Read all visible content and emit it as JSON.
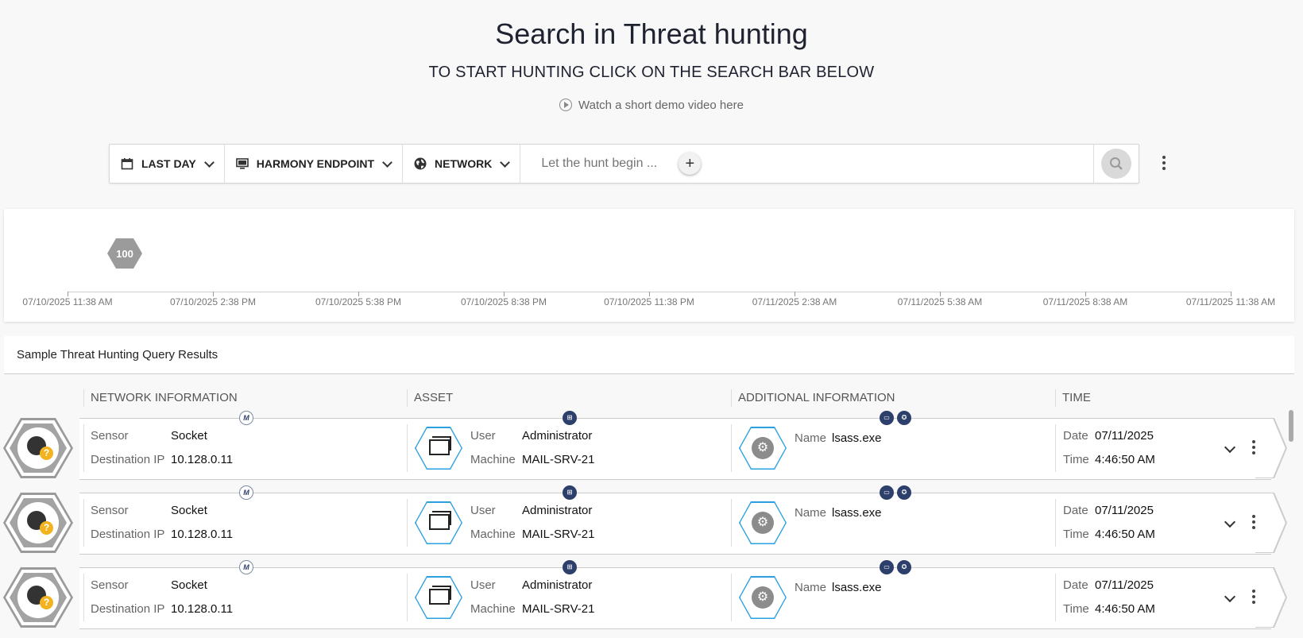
{
  "hero": {
    "title": "Search in Threat hunting",
    "subtitle": "TO START HUNTING CLICK ON THE SEARCH BAR BELOW",
    "demo_link": "Watch a short demo video here"
  },
  "search": {
    "filters": [
      {
        "label": "LAST DAY",
        "icon": "calendar-icon"
      },
      {
        "label": "HARMONY ENDPOINT",
        "icon": "monitor-icon"
      },
      {
        "label": "NETWORK",
        "icon": "globe-icon"
      }
    ],
    "placeholder": "Let the hunt begin ..."
  },
  "timeline": {
    "badge": "100",
    "ticks": [
      "07/10/2025 11:38 AM",
      "07/10/2025 2:38 PM",
      "07/10/2025 5:38 PM",
      "07/10/2025 8:38 PM",
      "07/10/2025 11:38 PM",
      "07/11/2025 2:38 AM",
      "07/11/2025 5:38 AM",
      "07/11/2025 8:38 AM",
      "07/11/2025 11:38 AM"
    ]
  },
  "results": {
    "title": "Sample Threat Hunting Query Results",
    "columns": [
      "NETWORK INFORMATION",
      "ASSET",
      "ADDITIONAL INFORMATION",
      "TIME"
    ],
    "labels": {
      "sensor": "Sensor",
      "destination_ip": "Destination IP",
      "user": "User",
      "machine": "Machine",
      "name": "Name",
      "date": "Date",
      "time": "Time"
    },
    "rows": [
      {
        "sensor": "Socket",
        "destination_ip": "10.128.0.11",
        "user": "Administrator",
        "machine": "MAIL-SRV-21",
        "name": "lsass.exe",
        "date": "07/11/2025",
        "time": "4:46:50 AM"
      },
      {
        "sensor": "Socket",
        "destination_ip": "10.128.0.11",
        "user": "Administrator",
        "machine": "MAIL-SRV-21",
        "name": "lsass.exe",
        "date": "07/11/2025",
        "time": "4:46:50 AM"
      },
      {
        "sensor": "Socket",
        "destination_ip": "10.128.0.11",
        "user": "Administrator",
        "machine": "MAIL-SRV-21",
        "name": "lsass.exe",
        "date": "07/11/2025",
        "time": "4:46:50 AM"
      }
    ],
    "badges": {
      "network": "M"
    }
  }
}
